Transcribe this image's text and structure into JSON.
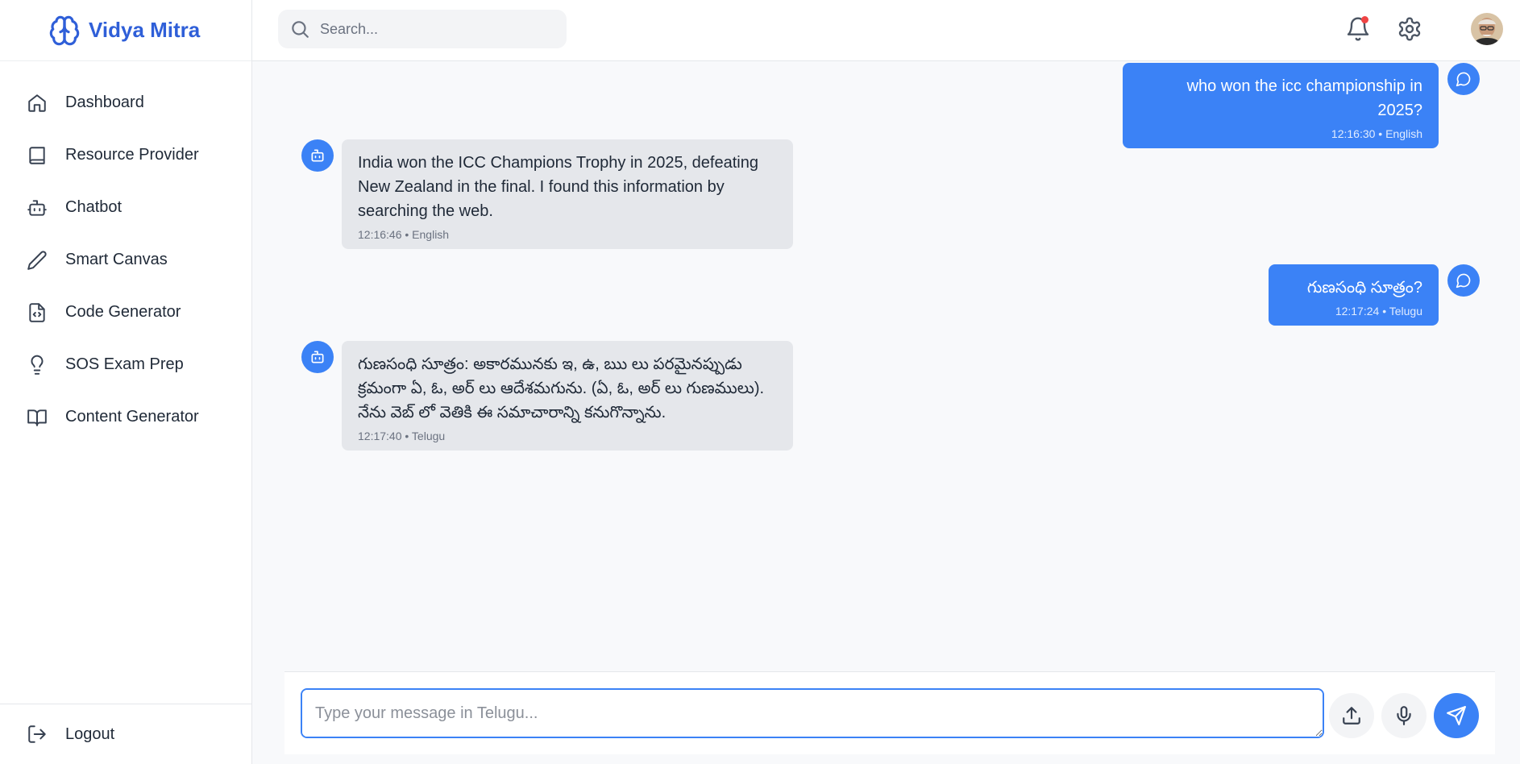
{
  "app": {
    "name": "Vidya Mitra"
  },
  "sidebar": {
    "items": [
      {
        "label": "Dashboard",
        "icon": "home-icon"
      },
      {
        "label": "Resource Provider",
        "icon": "book-icon"
      },
      {
        "label": "Chatbot",
        "icon": "bot-icon"
      },
      {
        "label": "Smart Canvas",
        "icon": "pencil-icon"
      },
      {
        "label": "Code Generator",
        "icon": "file-code-icon"
      },
      {
        "label": "SOS Exam Prep",
        "icon": "lightbulb-icon"
      },
      {
        "label": "Content Generator",
        "icon": "book-open-icon"
      }
    ],
    "logout_label": "Logout"
  },
  "header": {
    "search_placeholder": "Search...",
    "notification_dot_color": "#ef4444"
  },
  "chat": {
    "messages": [
      {
        "role": "user",
        "text": "who won the icc championship in 2025?",
        "meta": "12:16:30 • English"
      },
      {
        "role": "bot",
        "text": "India won the ICC Champions Trophy in 2025, defeating New Zealand in the final. I found this information by searching the web.",
        "meta": "12:16:46 • English"
      },
      {
        "role": "user",
        "text": "గుణసంధి సూత్రం?",
        "meta": "12:17:24 • Telugu"
      },
      {
        "role": "bot",
        "text": "గుణసంధి సూత్రం: అకారమునకు ఇ, ఉ, ఋ లు పరమైనప్పుడు క్రమంగా ఏ, ఓ, అర్ లు ఆదేశమగును. (ఏ, ఓ, అర్ లు గుణములు). నేను వెబ్ లో వెతికి ఈ సమాచారాన్ని కనుగొన్నాను.",
        "meta": "12:17:40 • Telugu"
      }
    ]
  },
  "composer": {
    "placeholder": "Type your message in Telugu..."
  },
  "colors": {
    "accent": "#3b82f6",
    "brand": "#2f5fd8",
    "bot_bubble": "#e5e7eb"
  }
}
